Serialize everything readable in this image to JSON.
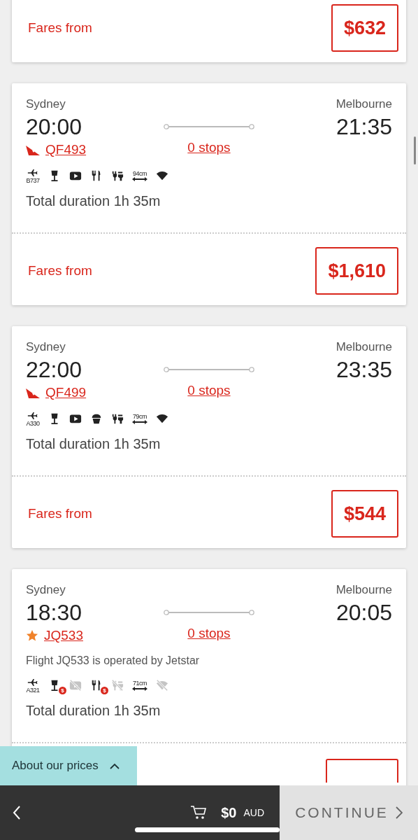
{
  "flights": [
    {
      "fare": {
        "label": "Fares from",
        "price": "$632"
      }
    },
    {
      "origin": "Sydney",
      "departure": "20:00",
      "destination": "Melbourne",
      "arrival": "21:35",
      "logo": {
        "kind": "qantas"
      },
      "flight_number": "QF493",
      "stops": "0 stops",
      "aircraft": "B737",
      "amenities": [
        {
          "kind": "drink",
          "available": true
        },
        {
          "kind": "video",
          "available": true
        },
        {
          "kind": "meal",
          "available": true
        },
        {
          "kind": "power",
          "available": true
        },
        {
          "kind": "seat",
          "label": "94cm",
          "available": true
        },
        {
          "kind": "wifi",
          "available": true
        }
      ],
      "duration": "Total duration 1h 35m",
      "fare": {
        "label": "Fares from",
        "price": "$1,610"
      }
    },
    {
      "origin": "Sydney",
      "departure": "22:00",
      "destination": "Melbourne",
      "arrival": "23:35",
      "logo": {
        "kind": "qantas"
      },
      "flight_number": "QF499",
      "stops": "0 stops",
      "aircraft": "A330",
      "amenities": [
        {
          "kind": "drink",
          "available": true
        },
        {
          "kind": "video",
          "available": true
        },
        {
          "kind": "snack",
          "available": true
        },
        {
          "kind": "power",
          "available": true
        },
        {
          "kind": "seat",
          "label": "79cm",
          "available": true
        },
        {
          "kind": "wifi",
          "available": true
        }
      ],
      "duration": "Total duration 1h 35m",
      "fare": {
        "label": "Fares from",
        "price": "$544"
      }
    },
    {
      "origin": "Sydney",
      "departure": "18:30",
      "destination": "Melbourne",
      "arrival": "20:05",
      "logo": {
        "kind": "jetstar"
      },
      "flight_number": "JQ533",
      "stops": "0 stops",
      "note": "Flight JQ533 is operated by Jetstar",
      "aircraft": "A321",
      "amenities": [
        {
          "kind": "drink",
          "available": true,
          "badge": "$"
        },
        {
          "kind": "video",
          "available": false
        },
        {
          "kind": "meal",
          "available": true,
          "badge": "$"
        },
        {
          "kind": "power",
          "available": false
        },
        {
          "kind": "seat",
          "label": "71cm",
          "available": true
        },
        {
          "kind": "wifi",
          "available": false
        }
      ],
      "duration": "Total duration 1h 35m",
      "fare": {
        "cut": true
      }
    }
  ],
  "prices_tab": {
    "label": "About our prices",
    "expanded": false
  },
  "bottom_bar": {
    "total": "$0",
    "currency": "AUD",
    "continue": "CONTINUE"
  }
}
